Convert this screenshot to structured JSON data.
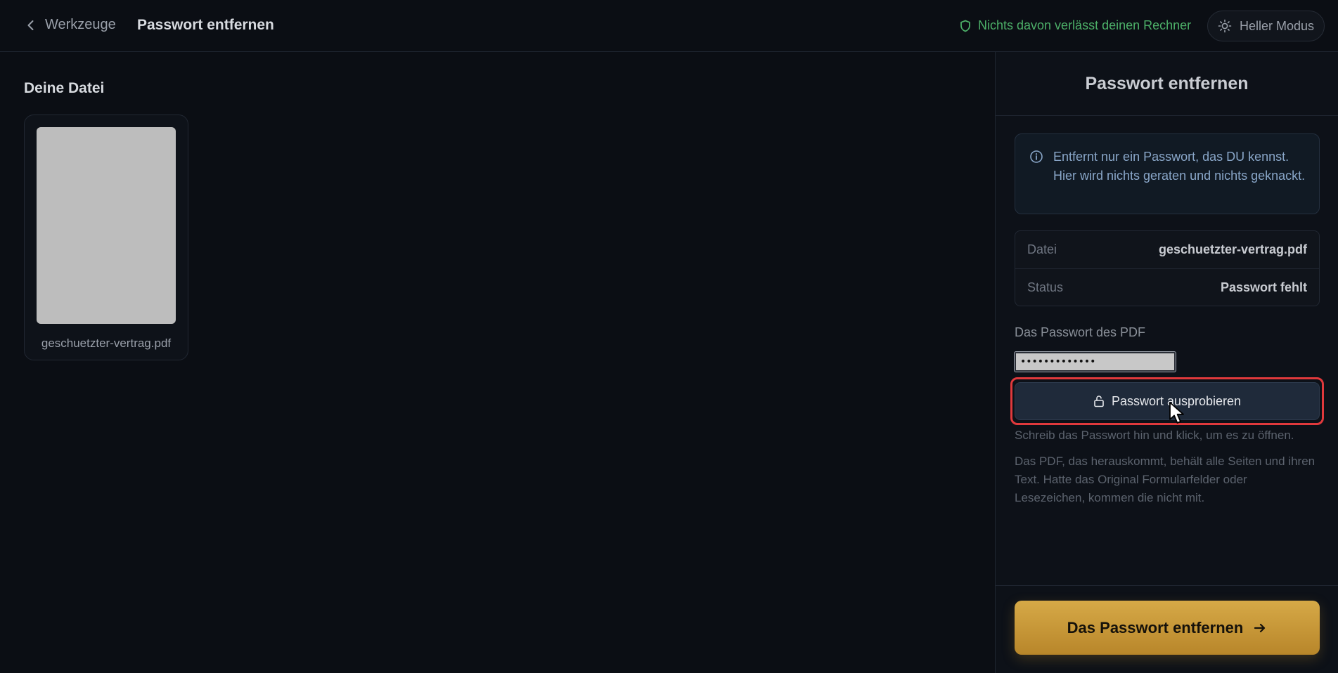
{
  "header": {
    "back_label": "Werkzeuge",
    "title": "Passwort entfernen",
    "privacy_text": "Nichts davon verlässt deinen Rechner",
    "mode_label": "Heller Modus"
  },
  "left": {
    "section_title": "Deine Datei",
    "file_name": "geschuetzter-vertrag.pdf"
  },
  "panel": {
    "title": "Passwort entfernen",
    "info_text": "Entfernt nur ein Passwort, das DU kennst. Hier wird nichts geraten und nichts geknackt.",
    "meta": [
      {
        "key": "Datei",
        "value": "geschuetzter-vertrag.pdf"
      },
      {
        "key": "Status",
        "value": "Passwort fehlt"
      }
    ],
    "password_label": "Das Passwort des PDF",
    "password_value": "•••••••••••••",
    "try_button": "Passwort ausprobieren",
    "hint": "Schreib das Passwort hin und klick, um es zu öffnen.",
    "note": "Das PDF, das herauskommt, behält alle Seiten und ihren Text. Hatte das Original Formularfelder oder Lesezeichen, kommen die nicht mit.",
    "remove_button": "Das Passwort entfernen"
  },
  "colors": {
    "background": "#0b0e14",
    "privacy_green": "#4caf68",
    "accent_gold": "#c8962f",
    "highlight_red": "#e0393c"
  },
  "icons": [
    "chevron-left-icon",
    "shield-icon",
    "sun-icon",
    "info-icon",
    "unlock-icon",
    "arrow-right-icon",
    "mouse-cursor-icon"
  ]
}
